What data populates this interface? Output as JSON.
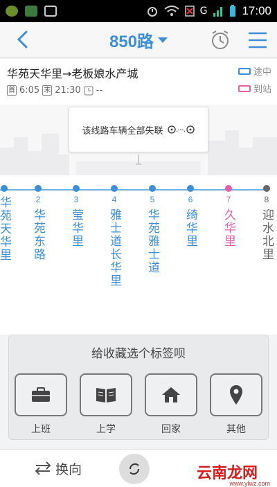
{
  "status_bar": {
    "network": "G",
    "time": "17:00",
    "icons": [
      "app-icon",
      "lock-icon",
      "image-icon",
      "alarm-icon",
      "wifi-icon",
      "no-sim-icon",
      "signal-icon",
      "battery-icon"
    ]
  },
  "header": {
    "title": "850路"
  },
  "route_info": {
    "direction": "华苑天华里→老板娘水产城",
    "first_tag": "首",
    "first_time": "6:05",
    "last_tag": "末",
    "last_time": "21:30",
    "interval": "--",
    "legend_en_route": "途中",
    "legend_arrived": "到站"
  },
  "map": {
    "message": "该线路车辆全部失联"
  },
  "stops": [
    {
      "num": "",
      "name": "华苑天华里",
      "color": "#3b8fd9"
    },
    {
      "num": "2",
      "name": "华苑东路",
      "color": "#3b8fd9"
    },
    {
      "num": "3",
      "name": "莹华里",
      "color": "#3b8fd9"
    },
    {
      "num": "4",
      "name": "雅士道长华里",
      "color": "#3b8fd9"
    },
    {
      "num": "5",
      "name": "华苑雅士道",
      "color": "#3b8fd9"
    },
    {
      "num": "6",
      "name": "绮华里",
      "color": "#3b8fd9"
    },
    {
      "num": "7",
      "name": "久华里",
      "color": "#e65fa6"
    },
    {
      "num": "8",
      "name": "迎水北里",
      "color": "#666666"
    }
  ],
  "panel": {
    "title": "给收藏选个标签呗",
    "tags": [
      {
        "label": "上班",
        "icon": "briefcase-icon"
      },
      {
        "label": "上学",
        "icon": "book-icon"
      },
      {
        "label": "回家",
        "icon": "home-icon"
      },
      {
        "label": "其他",
        "icon": "location-pin-icon"
      }
    ]
  },
  "bottom": {
    "switch_label": "换向",
    "watermark": "云南龙网",
    "watermark_url": "www.ylwz.com"
  },
  "colors": {
    "accent": "#3b8fd9",
    "current_stop": "#e65fa6"
  }
}
